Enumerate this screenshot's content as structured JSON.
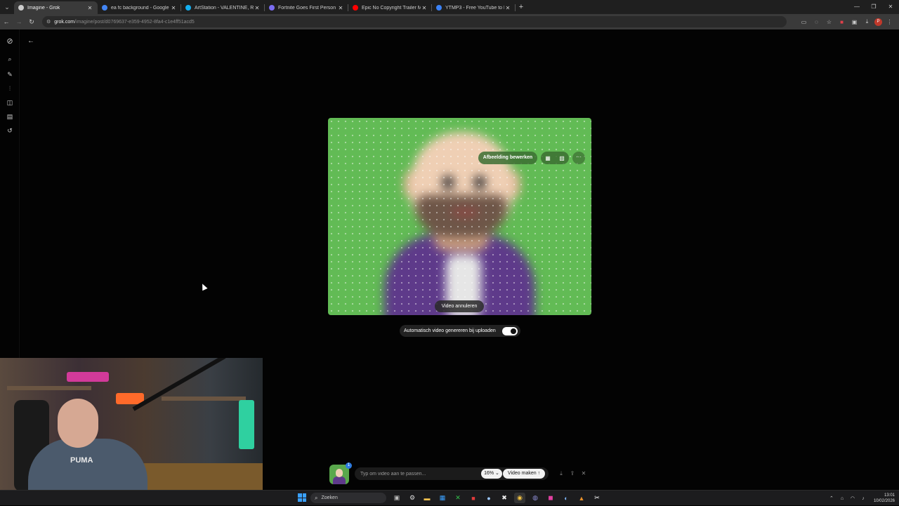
{
  "browser": {
    "tabs": [
      {
        "title": "Imagine - Grok",
        "active": true,
        "favicon_color": "#cccccc"
      },
      {
        "title": "ea fc background - Google Zoe",
        "active": false,
        "favicon_color": "#4285f4"
      },
      {
        "title": "ArtStation - VALENTINE, RED D",
        "active": false,
        "favicon_color": "#13aff0"
      },
      {
        "title": "Fortnite Goes First Person with",
        "active": false,
        "favicon_color": "#7a6cf0"
      },
      {
        "title": "Epic No Copyright Trailer Musi",
        "active": false,
        "favicon_color": "#ff0000"
      },
      {
        "title": "YTMP3 - Free YouTube to MP3",
        "active": false,
        "favicon_color": "#3b82f6"
      }
    ],
    "new_tab": "+",
    "url_host": "grok.com",
    "url_path": "/imagine/post/d0769637-e359-4952-8fa4-c1e4ff51acd5",
    "profile_initial": "P"
  },
  "card": {
    "edit_label": "Afbeelding bewerken",
    "more_label": "···",
    "cancel_label": "Video annuleren",
    "auto_label": "Automatisch video genereren bij uploaden",
    "auto_enabled": true
  },
  "webcam": {
    "shirt_text": "PUMA"
  },
  "composer": {
    "placeholder": "Typ om video aan te passen...",
    "thumb_badge": "1",
    "percent_label": "16% ⌄",
    "make_label": "Video maken ↑"
  },
  "taskbar": {
    "search_label": "Zoeken",
    "time": "13:01",
    "date": "10/02/2026"
  },
  "colors": {
    "accent_green": "#62bb55",
    "shirt_purple": "#5e3a8a",
    "profile_red": "#c0392b"
  }
}
